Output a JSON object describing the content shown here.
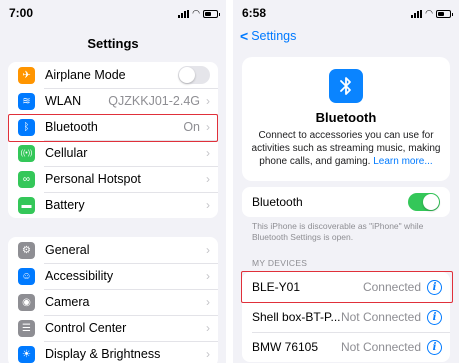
{
  "left": {
    "status_time": "7:00",
    "title": "Settings",
    "group1": [
      {
        "name": "airplane",
        "label": "Airplane Mode",
        "value": "",
        "icon_color": "#ff9500",
        "glyph": "✈",
        "control": "toggle-off"
      },
      {
        "name": "wlan",
        "label": "WLAN",
        "value": "QJZKKJ01-2.4G",
        "icon_color": "#007aff",
        "glyph": "≋",
        "control": "chevron"
      },
      {
        "name": "bluetooth",
        "label": "Bluetooth",
        "value": "On",
        "icon_color": "#007aff",
        "glyph": "ᛒ",
        "control": "chevron"
      },
      {
        "name": "cellular",
        "label": "Cellular",
        "value": "",
        "icon_color": "#34c759",
        "glyph": "((•))",
        "control": "chevron"
      },
      {
        "name": "personal-hotspot",
        "label": "Personal Hotspot",
        "value": "",
        "icon_color": "#34c759",
        "glyph": "∞",
        "control": "chevron"
      },
      {
        "name": "battery",
        "label": "Battery",
        "value": "",
        "icon_color": "#34c759",
        "glyph": "▬",
        "control": "chevron"
      }
    ],
    "group2": [
      {
        "name": "general",
        "label": "General",
        "icon_color": "#8e8e93",
        "glyph": "⚙"
      },
      {
        "name": "accessibility",
        "label": "Accessibility",
        "icon_color": "#007aff",
        "glyph": "☺"
      },
      {
        "name": "camera",
        "label": "Camera",
        "icon_color": "#8e8e93",
        "glyph": "◉"
      },
      {
        "name": "control-center",
        "label": "Control Center",
        "icon_color": "#8e8e93",
        "glyph": "☰"
      },
      {
        "name": "display-brightness",
        "label": "Display & Brightness",
        "icon_color": "#007aff",
        "glyph": "☀"
      }
    ]
  },
  "right": {
    "status_time": "6:58",
    "back_label": "Settings",
    "title": "Bluetooth",
    "description": "Connect to accessories you can use for activities such as streaming music, making phone calls, and gaming.",
    "learn_more": "Learn more...",
    "toggle_label": "Bluetooth",
    "toggle_on": true,
    "discoverable_note": "This iPhone is discoverable as \"iPhone\" while Bluetooth Settings is open.",
    "devices_header": "MY DEVICES",
    "devices": [
      {
        "name": "BLE-Y01",
        "status": "Connected"
      },
      {
        "name": "Shell box-BT-P...",
        "status": "Not Connected"
      },
      {
        "name": "BMW 76105",
        "status": "Not Connected"
      }
    ]
  },
  "colors": {
    "accent": "#007aff",
    "highlight": "#e0303a",
    "toggle_on": "#34c759"
  }
}
